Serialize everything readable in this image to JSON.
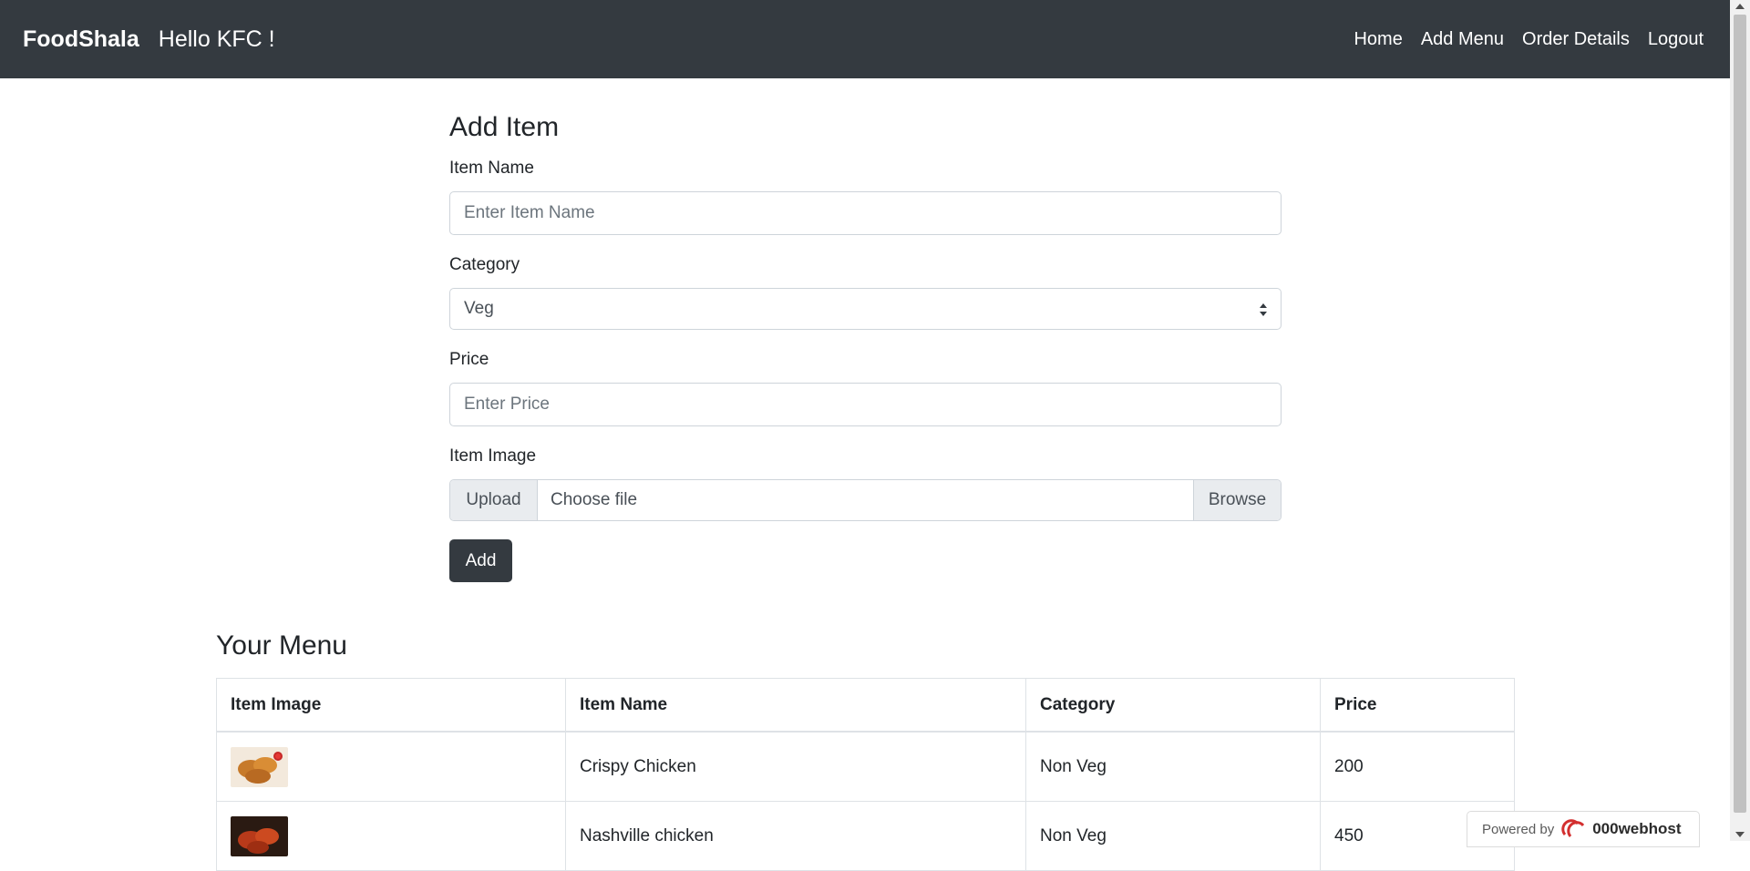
{
  "navbar": {
    "brand": "FoodShala",
    "greeting": "Hello KFC !",
    "links": [
      "Home",
      "Add Menu",
      "Order Details",
      "Logout"
    ]
  },
  "form": {
    "title": "Add Item",
    "item_name_label": "Item Name",
    "item_name_placeholder": "Enter Item Name",
    "category_label": "Category",
    "category_selected": "Veg",
    "price_label": "Price",
    "price_placeholder": "Enter Price",
    "image_label": "Item Image",
    "upload_label": "Upload",
    "file_placeholder": "Choose file",
    "browse_label": "Browse",
    "submit_label": "Add"
  },
  "menu": {
    "title": "Your Menu",
    "columns": [
      "Item Image",
      "Item Name",
      "Category",
      "Price"
    ],
    "rows": [
      {
        "name": "Crispy Chicken",
        "category": "Non Veg",
        "price": "200"
      },
      {
        "name": "Nashville chicken",
        "category": "Non Veg",
        "price": "450"
      }
    ]
  },
  "footer_badge": {
    "prefix": "Powered by",
    "brand": "000webhost"
  },
  "colors": {
    "navbar_bg": "#343a40",
    "button_bg": "#343a40",
    "input_group_bg": "#e9ecef"
  }
}
